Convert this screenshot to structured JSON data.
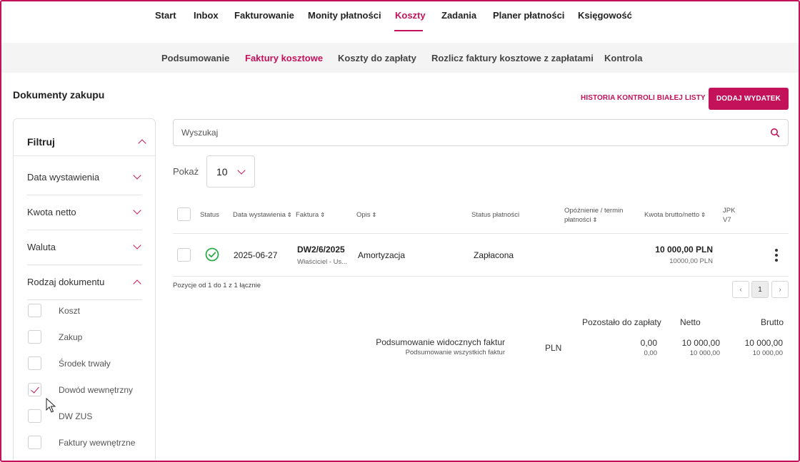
{
  "topnav": {
    "items": [
      "Start",
      "Inbox",
      "Fakturowanie",
      "Monity płatności",
      "Koszty",
      "Zadania",
      "Planer płatności",
      "Księgowość"
    ]
  },
  "subnav": {
    "items": [
      "Podsumowanie",
      "Faktury kosztowe",
      "Koszty do zapłaty",
      "Rozlicz faktury kosztowe z zapłatami",
      "Kontrola"
    ]
  },
  "header": {
    "title": "Dokumenty zakupu",
    "whitelist_link": "HISTORIA KONTROLI BIAŁEJ LISTY",
    "add_button": "DODAJ WYDATEK"
  },
  "filters": {
    "title": "Filtruj",
    "sections": [
      "Data wystawienia",
      "Kwota netto",
      "Waluta",
      "Rodzaj dokumentu"
    ],
    "doc_types": [
      {
        "label": "Koszt",
        "checked": false
      },
      {
        "label": "Zakup",
        "checked": false
      },
      {
        "label": "Środek trwały",
        "checked": false
      },
      {
        "label": "Dowód wewnętrzny",
        "checked": true
      },
      {
        "label": "DW ZUS",
        "checked": false
      },
      {
        "label": "Faktury wewnętrzne",
        "checked": false
      }
    ]
  },
  "search": {
    "placeholder": "Wyszukaj"
  },
  "page_size": {
    "label": "Pokaż",
    "value": "10"
  },
  "table": {
    "headers": {
      "status": "Status",
      "date": "Data wystawienia",
      "invoice": "Faktura",
      "description": "Opis",
      "payment_status": "Status płatności",
      "delay_line1": "Opóźnienie / termin",
      "delay_line2": "płatności",
      "amount": "Kwota brutto/netto",
      "jpk_line1": "JPK",
      "jpk_line2": "V7"
    },
    "rows": [
      {
        "date": "2025-06-27",
        "invoice_number": "DW2/6/2025",
        "invoice_sub": "Właściciel - Us...",
        "description": "Amortyzacja",
        "payment_status": "Zapłacona",
        "gross": "10 000,00 PLN",
        "net": "10000,00 PLN"
      }
    ]
  },
  "pagination": {
    "info": "Pozycje od 1 do 1 z 1 łącznie",
    "prev": "‹",
    "current": "1",
    "next": "›"
  },
  "summary": {
    "col_remaining": "Pozostało do zapłaty",
    "col_net": "Netto",
    "col_gross": "Brutto",
    "visible_label": "Podsumowanie widocznych faktur",
    "all_label": "Podsumowanie wszystkich faktur",
    "currency": "PLN",
    "visible_remaining": "0,00",
    "all_remaining": "0,00",
    "visible_net": "10 000,00",
    "all_net": "10 000,00",
    "visible_gross": "10 000,00",
    "all_gross": "10 000,00"
  },
  "colors": {
    "accent": "#c4125a",
    "success": "#2eaa4a"
  }
}
